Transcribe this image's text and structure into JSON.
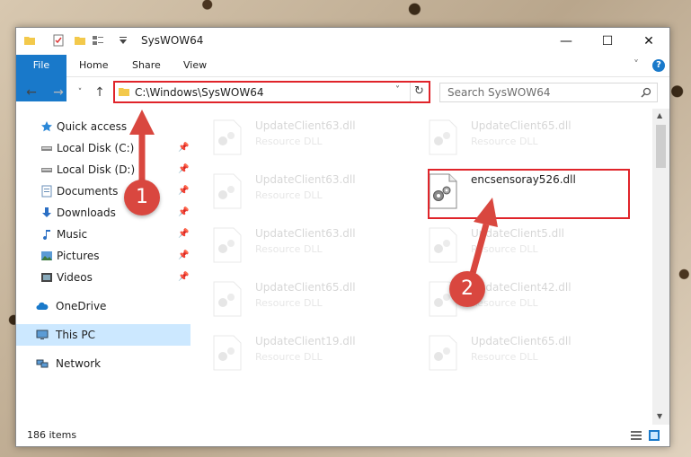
{
  "window": {
    "title": "SysWOW64",
    "controls": {
      "minimize": "—",
      "maximize": "☐",
      "close": "✕"
    }
  },
  "ribbon": {
    "tabs": [
      "File",
      "Home",
      "Share",
      "View"
    ],
    "help": "?",
    "collapse": "˅"
  },
  "address": {
    "path": "C:\\Windows\\SysWOW64",
    "search_placeholder": "Search SysWOW64"
  },
  "sidebar": {
    "items": [
      {
        "label": "Quick access",
        "icon": "star-icon"
      },
      {
        "label": "Local Disk (C:)",
        "icon": "drive-icon",
        "pinned": true
      },
      {
        "label": "Local Disk (D:)",
        "icon": "drive-icon",
        "pinned": true
      },
      {
        "label": "Documents",
        "icon": "documents-icon",
        "pinned": true
      },
      {
        "label": "Downloads",
        "icon": "download-icon",
        "pinned": true
      },
      {
        "label": "Music",
        "icon": "music-icon",
        "pinned": true
      },
      {
        "label": "Pictures",
        "icon": "pictures-icon",
        "pinned": true
      },
      {
        "label": "Videos",
        "icon": "videos-icon",
        "pinned": true
      },
      {
        "label": "OneDrive",
        "icon": "cloud-icon"
      },
      {
        "label": "This PC",
        "icon": "pc-icon",
        "selected": true
      },
      {
        "label": "Network",
        "icon": "network-icon"
      }
    ]
  },
  "files": [
    {
      "name": "UpdateClient63.dll",
      "type": "Resource DLL"
    },
    {
      "name": "UpdateClient65.dll",
      "type": "Resource DLL"
    },
    {
      "name": "UpdateClient63.dll",
      "type": "Resource DLL"
    },
    {
      "name": "encsensoray526.dll",
      "type": ""
    },
    {
      "name": "UpdateClient63.dll",
      "type": "Resource DLL"
    },
    {
      "name": "UpdateClient5.dll",
      "type": "Resource DLL"
    },
    {
      "name": "UpdateClient65.dll",
      "type": "Resource DLL"
    },
    {
      "name": "UpdateClient42.dll",
      "type": "Resource DLL"
    },
    {
      "name": "UpdateClient19.dll",
      "type": "Resource DLL"
    },
    {
      "name": "UpdateClient65.dll",
      "type": "Resource DLL"
    }
  ],
  "status": {
    "items_count": "186 items"
  },
  "annotations": {
    "step1": "1",
    "step2": "2"
  },
  "colors": {
    "accent": "#1979ca",
    "highlight": "#e0242a",
    "badge": "#d9473f",
    "selected": "#cce8ff"
  }
}
